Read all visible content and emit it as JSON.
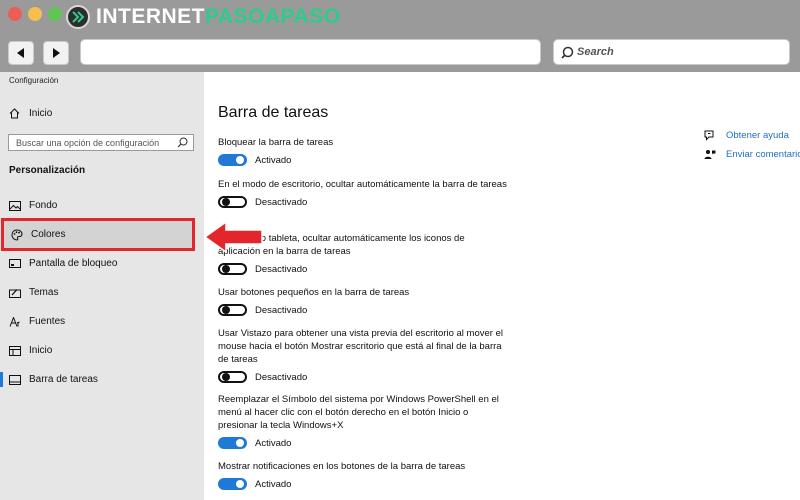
{
  "browser": {
    "brand_part1": "INTERNET",
    "brand_part2": "PASOAPASO",
    "search_placeholder": "Search",
    "colors": {
      "chrome": "#9a9a9a",
      "brand_green": "#2ecc8a"
    }
  },
  "settings": {
    "window_title": "Configuración",
    "home_label": "Inicio",
    "search_placeholder": "Buscar una opción de configuración",
    "section_title": "Personalización",
    "nav_items": [
      {
        "label": "Fondo",
        "icon": "picture-icon"
      },
      {
        "label": "Colores",
        "icon": "palette-icon",
        "highlighted": true
      },
      {
        "label": "Pantalla de bloqueo",
        "icon": "lock-screen-icon"
      },
      {
        "label": "Temas",
        "icon": "brush-icon"
      },
      {
        "label": "Fuentes",
        "icon": "font-icon"
      },
      {
        "label": "Inicio",
        "icon": "start-icon"
      },
      {
        "label": "Barra de tareas",
        "icon": "taskbar-icon",
        "active": true
      }
    ],
    "page_title": "Barra de tareas",
    "options": [
      {
        "label": "Bloquear la barra de tareas",
        "state": "Activado",
        "on": true
      },
      {
        "label": "En el modo de escritorio, ocultar automáticamente la barra de tareas",
        "state": "Desactivado",
        "on": false
      },
      {
        "label": "En el modo tableta, ocultar automáticamente los iconos de aplicación en la barra de tareas",
        "state": "Desactivado",
        "on": false
      },
      {
        "label": "Usar botones pequeños en la barra de tareas",
        "state": "Desactivado",
        "on": false
      },
      {
        "label": "Usar Vistazo para obtener una vista previa del escritorio al mover el mouse hacia el botón Mostrar escritorio que está al final de la barra de tareas",
        "state": "Desactivado",
        "on": false
      },
      {
        "label": "Reemplazar el Símbolo del sistema por Windows PowerShell en el menú al hacer clic con el botón derecho en el botón Inicio o presionar la tecla Windows+X",
        "state": "Activado",
        "on": true
      },
      {
        "label": "Mostrar notificaciones en los botones de la barra de tareas",
        "state": "Activado",
        "on": true
      }
    ],
    "help_links": [
      {
        "label": "Obtener ayuda",
        "icon": "help-chat-icon"
      },
      {
        "label": "Enviar comentarios",
        "icon": "feedback-icon"
      }
    ],
    "colors": {
      "accent": "#1f7ad6",
      "highlight": "#e3262c",
      "sidebar_bg": "#e6e6e6"
    }
  }
}
